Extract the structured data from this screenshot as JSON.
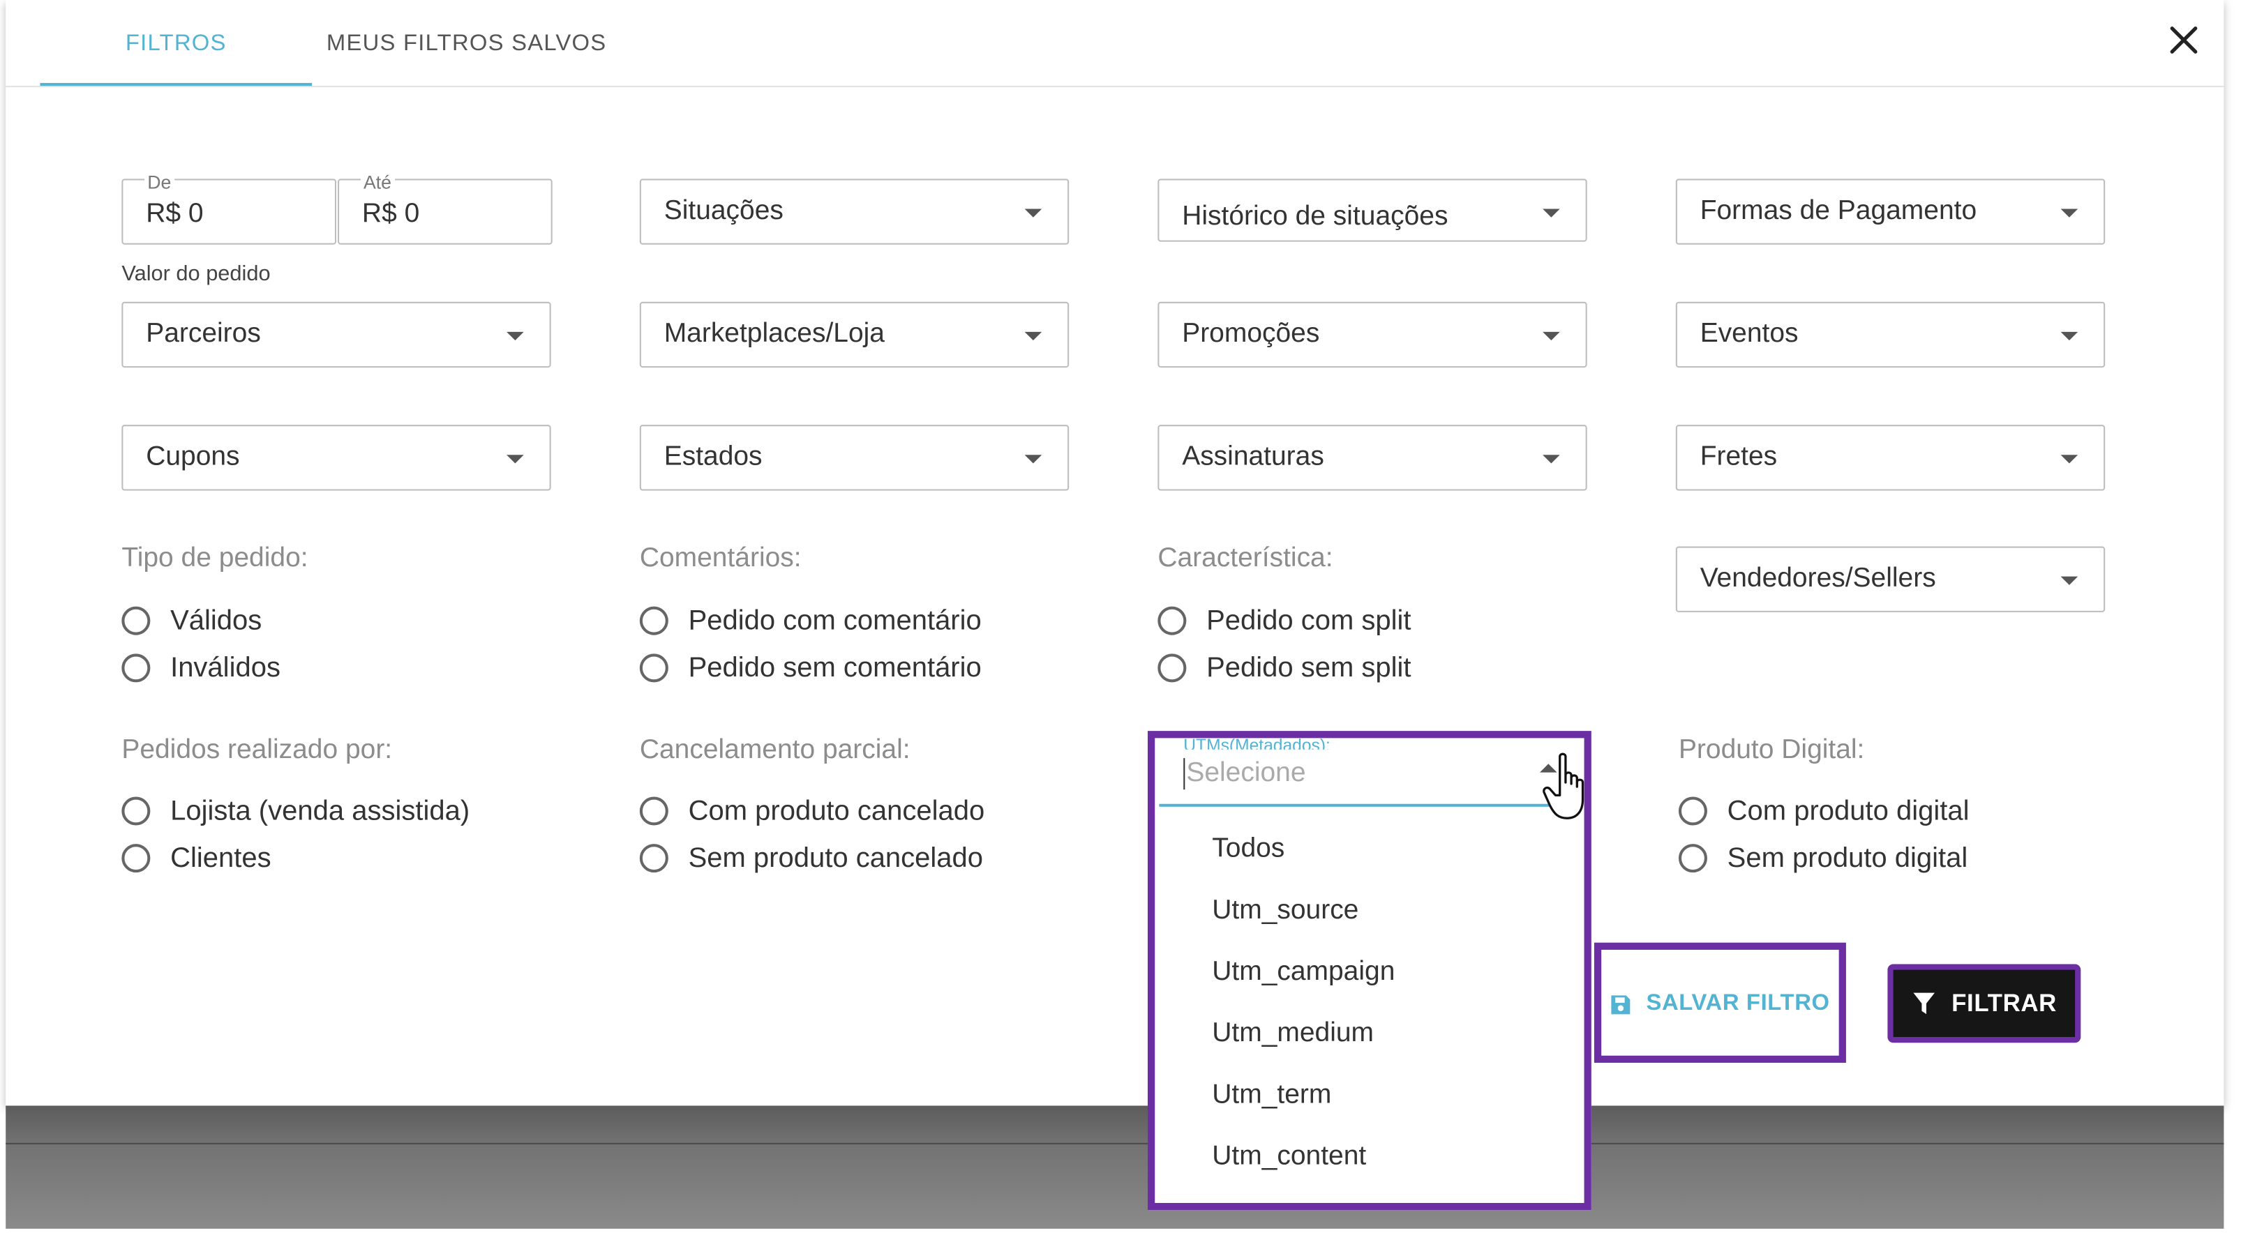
{
  "tabs": {
    "filters": "FILTROS",
    "saved": "MEUS FILTROS SALVOS"
  },
  "close_icon": "close-icon",
  "order_value": {
    "from_label": "De",
    "from_value": "R$ 0",
    "to_label": "Até",
    "to_value": "R$ 0",
    "caption": "Valor do pedido"
  },
  "selects": {
    "situacoes": "Situações",
    "historico": "Histórico de situações",
    "pagamento": "Formas de Pagamento",
    "parceiros": "Parceiros",
    "marketplaces": "Marketplaces/Loja",
    "promocoes": "Promoções",
    "eventos": "Eventos",
    "cupons": "Cupons",
    "estados": "Estados",
    "assinaturas": "Assinaturas",
    "fretes": "Fretes",
    "vendedores": "Vendedores/Sellers"
  },
  "tipo_pedido": {
    "title": "Tipo de pedido:",
    "opt1": "Válidos",
    "opt2": "Inválidos"
  },
  "comentarios": {
    "title": "Comentários:",
    "opt1": "Pedido com comentário",
    "opt2": "Pedido sem comentário"
  },
  "caracteristica": {
    "title": "Característica:",
    "opt1": "Pedido com split",
    "opt2": "Pedido sem split"
  },
  "realizado_por": {
    "title": "Pedidos realizado por:",
    "opt1": "Lojista (venda assistida)",
    "opt2": "Clientes"
  },
  "cancelamento": {
    "title": "Cancelamento parcial:",
    "opt1": "Com produto cancelado",
    "opt2": "Sem produto cancelado"
  },
  "produto_digital": {
    "title": "Produto Digital:",
    "opt1": "Com produto digital",
    "opt2": "Sem produto digital"
  },
  "utm": {
    "label": "UTMs(Metadados):",
    "placeholder": "Selecione",
    "options": [
      "Todos",
      "Utm_source",
      "Utm_campaign",
      "Utm_medium",
      "Utm_term",
      "Utm_content"
    ]
  },
  "actions": {
    "save": "SALVAR FILTRO",
    "filter": "FILTRAR"
  },
  "colors": {
    "accent": "#53b3d3",
    "highlight": "#6b2fa3",
    "primary_button": "#161616"
  }
}
